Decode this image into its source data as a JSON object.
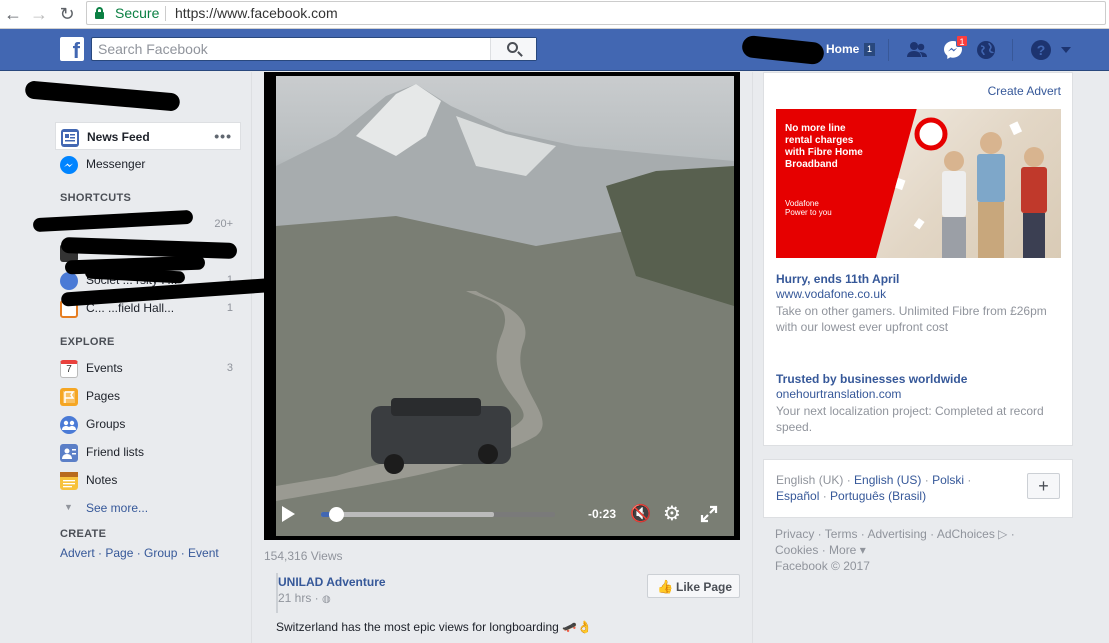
{
  "browser": {
    "secure_label": "Secure",
    "url": "https://www.facebook.com"
  },
  "header": {
    "search_placeholder": "Search Facebook",
    "home_label": "Home",
    "home_count": "1",
    "notification_count": "1",
    "help_label": "?"
  },
  "leftnav": {
    "news_feed": "News Feed",
    "messenger": "Messenger",
    "shortcuts_header": "SHORTCUTS",
    "shortcut_counts": [
      "20+",
      "1",
      "1"
    ],
    "shortcut_partial_labels": [
      "Societ ... rsity F...",
      "C... ...field Hall..."
    ],
    "explore_header": "EXPLORE",
    "explore_items": [
      {
        "label": "Events",
        "count": "3"
      },
      {
        "label": "Pages",
        "count": ""
      },
      {
        "label": "Groups",
        "count": ""
      },
      {
        "label": "Friend lists",
        "count": ""
      },
      {
        "label": "Notes",
        "count": ""
      }
    ],
    "see_more": "See more...",
    "create_header": "CREATE",
    "create_links": "Advert · Page · Group · Event",
    "events_calendar_day": "7"
  },
  "video": {
    "time_remaining": "-0:23",
    "progress_fraction": 0.06,
    "buffered_fraction": 0.74,
    "views": "154,316 Views"
  },
  "post": {
    "page_name": "UNILAD Adventure",
    "time": "21 hrs · ",
    "like_page_label": "Like Page",
    "caption": "Switzerland has the most epic views for longboarding 🛹👌"
  },
  "ads": {
    "create_advert": "Create Advert",
    "ad1": {
      "image_headline": "No more line rental charges with Fibre Home Broadband",
      "image_brand": "Vodafone",
      "image_tagline": "Power to you",
      "title": "Hurry, ends 11th April",
      "domain": "www.vodafone.co.uk",
      "description": "Take on other gamers. Unlimited Fibre from £26pm with our lowest ever upfront cost"
    },
    "ad2": {
      "title": "Trusted by businesses worldwide",
      "domain": "onehourtranslation.com",
      "description": "Your next localization project: Completed at record speed."
    }
  },
  "languages": {
    "line1": [
      {
        "label": "English (UK)",
        "link": false
      },
      {
        "label": "English (US)",
        "link": true
      },
      {
        "label": "Polski",
        "link": true
      }
    ],
    "line2": [
      {
        "label": "Español",
        "link": true
      },
      {
        "label": "Português (Brasil)",
        "link": true
      }
    ],
    "plus_label": "+"
  },
  "footer": {
    "line1": "Privacy · Terms · Advertising · AdChoices ▷ ·",
    "line2": "Cookies · More ▾",
    "line3": "Facebook © 2017"
  },
  "colors": {
    "fb_blue": "#4267b2",
    "link_blue": "#365899",
    "vodafone_red": "#e60000",
    "notification_red": "#fa3e3e",
    "secure_green": "#0b8043"
  }
}
